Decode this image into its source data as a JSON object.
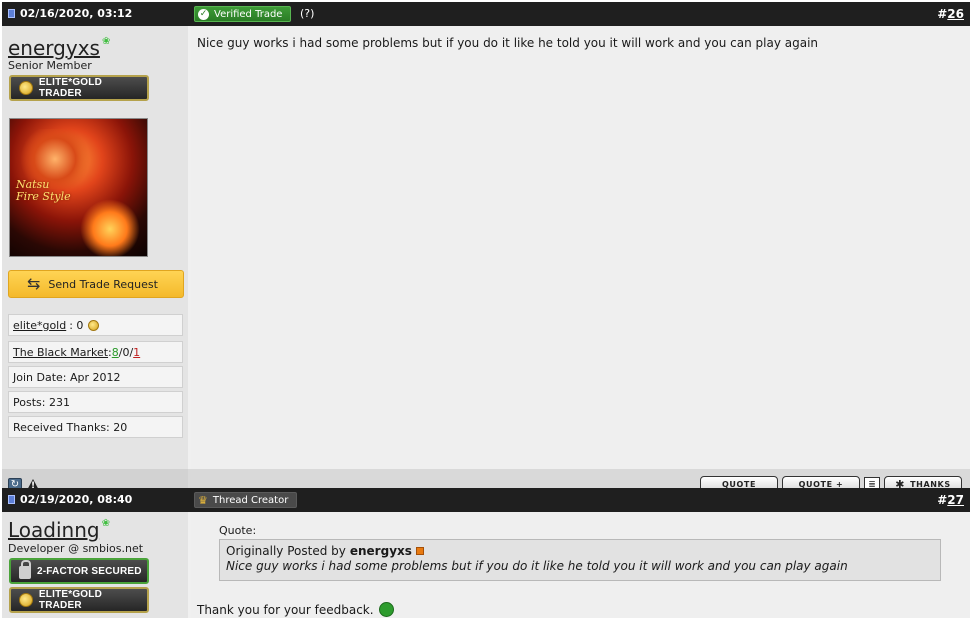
{
  "posts": [
    {
      "date": "02/16/2020, 03:12",
      "badge": "Verified Trade",
      "help": "(?)",
      "number_prefix": "#",
      "number": "26",
      "username": "energyxs",
      "user_title": "Senior Member",
      "rank_label": "ELITE*GOLD TRADER",
      "avatar_text": "Natsu\nFire Style",
      "trade_button": "Send Trade Request",
      "stats": {
        "elitegold_label": "elite*gold",
        "elitegold_value": ": 0",
        "blackmarket_label": "The Black Market",
        "bm_sep": ": ",
        "bm_positive": "8",
        "bm_neutral": "/0/",
        "bm_negative": "1",
        "join_date": "Join Date: Apr 2012",
        "posts": "Posts: 231",
        "thanks": "Received Thanks: 20"
      },
      "message": "Nice guy works i had some problems but if you do it like he told you it will work and you can play again",
      "buttons": {
        "quote": "QUOTE",
        "quote_plus": "QUOTE +",
        "thanks": "THANKS"
      }
    },
    {
      "date": "02/19/2020, 08:40",
      "badge": "Thread Creator",
      "number_prefix": "#",
      "number": "27",
      "username": "Loadinng",
      "user_title": "Developer @ smbios.net",
      "rank_label_1": "2-FACTOR SECURED",
      "rank_label_2": "ELITE*GOLD TRADER",
      "quote_label": "Quote:",
      "quote_by_prefix": "Originally Posted by",
      "quote_author": "energyxs",
      "quote_text": "Nice guy works i had some problems but if you do it like he told you it will work and you can play again",
      "reply": "Thank you for your feedback."
    }
  ]
}
